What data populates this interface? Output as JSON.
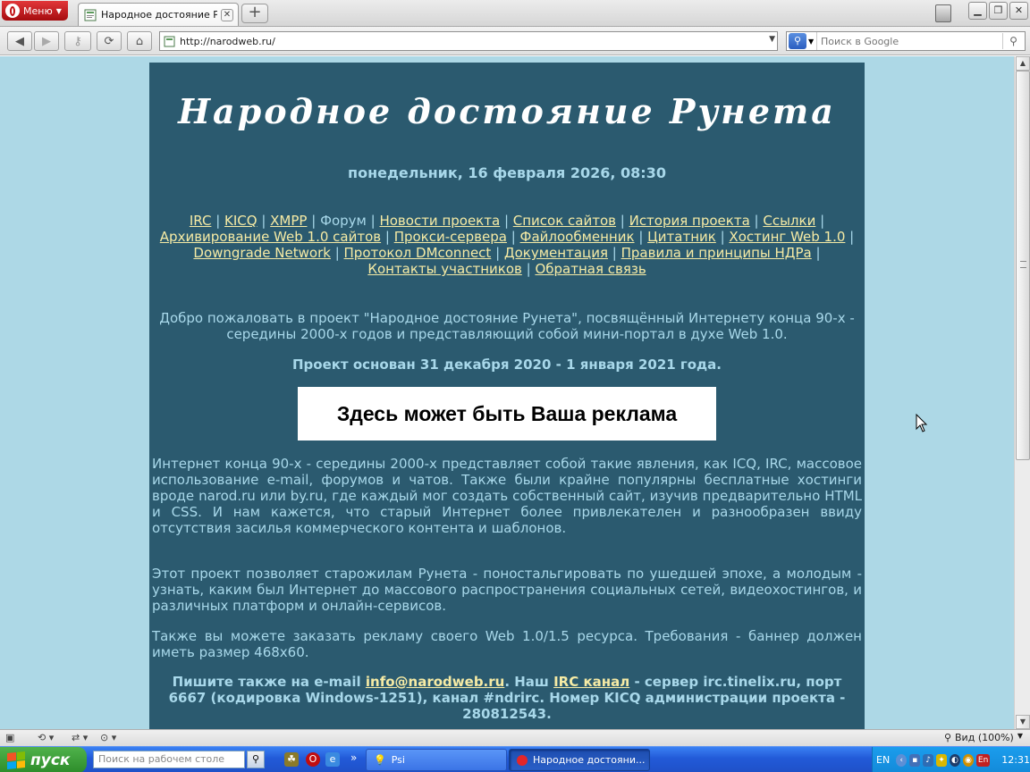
{
  "browser": {
    "menu_label": "Меню",
    "tab_title": "Народное достояние Р...",
    "url": "http://narodweb.ru/",
    "search_placeholder": "Поиск в Google",
    "zoom_label": "Вид (100%)"
  },
  "site": {
    "title": "Народное достояние Рунета",
    "date": "понедельник, 16 февраля 2026, 08:30",
    "nav": [
      {
        "label": "IRC",
        "link": true
      },
      {
        "label": "KICQ",
        "link": true
      },
      {
        "label": "XMPP",
        "link": true
      },
      {
        "label": "Форум",
        "link": false
      },
      {
        "label": "Новости проекта",
        "link": true
      },
      {
        "label": "Список сайтов",
        "link": true
      },
      {
        "label": "История проекта",
        "link": true
      },
      {
        "label": "Ссылки",
        "link": true
      },
      {
        "label": "Архивирование Web 1.0 сайтов",
        "link": true
      },
      {
        "label": "Прокси-сервера",
        "link": true
      },
      {
        "label": "Файлообменник",
        "link": true
      },
      {
        "label": "Цитатник",
        "link": true
      },
      {
        "label": "Хостинг Web 1.0",
        "link": true
      },
      {
        "label": "Downgrade Network",
        "link": true
      },
      {
        "label": "Протокол DMconnect",
        "link": true
      },
      {
        "label": "Документация",
        "link": true
      },
      {
        "label": "Правила и принципы НДРа",
        "link": true
      },
      {
        "label": "Контакты участников",
        "link": true
      },
      {
        "label": "Обратная связь",
        "link": true
      }
    ],
    "welcome": "Добро пожаловать в проект \"Народное достояние Рунета\", посвящённый Интернету конца 90-х - середины 2000-х годов и представляющий собой мини-портал в духе Web 1.0.",
    "founded": "Проект основан 31 декабря 2020 - 1 января 2021 года.",
    "ad_banner": "Здесь может быть Ваша реклама",
    "para1": "Интернет конца 90-х - середины 2000-х представляет собой такие явления, как ICQ, IRC, массовое использование e-mail, форумов и чатов. Также были крайне популярны бесплатные хостинги вроде narod.ru или by.ru, где каждый мог создать собственный сайт, изучив предварительно HTML и CSS. И нам кажется, что старый Интернет более привлекателен и разнообразен ввиду отсутствия засилья коммерческого контента и шаблонов.",
    "para2": "Этот проект позволяет старожилам Рунета - поностальгировать по ушедшей эпохе, а молодым - узнать, каким был Интернет до массового распространения социальных сетей, видеохостингов, и различных платформ и онлайн-сервисов.",
    "para3": "Также вы можете заказать рекламу своего Web 1.0/1.5 ресурса. Требования - баннер должен иметь размер 468x60.",
    "contact": {
      "prefix": "Пишите также на e-mail ",
      "email": "info@narodweb.ru",
      "mid": ". Наш ",
      "irc_link": "IRC канал",
      "suffix": " - сервер irc.tinelix.ru, порт 6667 (кодировка Windows-1251), канал #ndrirc. Номер KICQ администрации проекта - 280812543."
    }
  },
  "taskbar": {
    "start_label": "пуск",
    "desktop_search_placeholder": "Поиск на рабочем столе",
    "tasks": [
      {
        "label": "Psi",
        "active": false
      },
      {
        "label": "Народное достояни...",
        "active": true
      }
    ],
    "lang": "EN",
    "lang_indicator": "En",
    "clock": "12:31"
  },
  "colors": {
    "page_bg": "#add8e6",
    "content_bg": "#2b5a6f",
    "text": "#a8d8ea",
    "link": "#f6eba5"
  }
}
